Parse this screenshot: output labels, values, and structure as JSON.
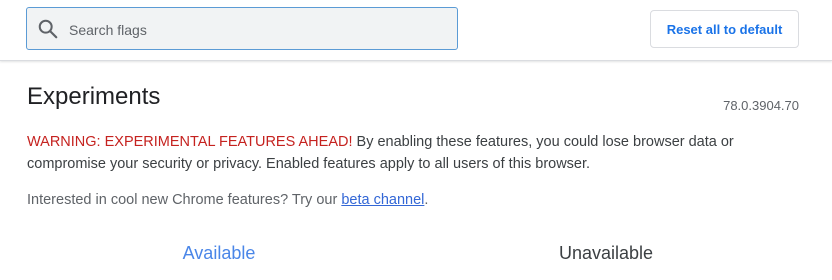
{
  "search": {
    "placeholder": "Search flags",
    "icon": "search-icon"
  },
  "header": {
    "reset_label": "Reset all to default"
  },
  "main": {
    "title": "Experiments",
    "version": "78.0.3904.70",
    "warning_strong": "WARNING: EXPERIMENTAL FEATURES AHEAD!",
    "warning_text": " By enabling these features, you could lose browser data or compromise your security or privacy. Enabled features apply to all users of this browser.",
    "promo_text": "Interested in cool new Chrome features? Try our ",
    "promo_link": "beta channel",
    "promo_end": "."
  },
  "tabs": [
    {
      "label": "Available",
      "selected": true
    },
    {
      "label": "Unavailable",
      "selected": false
    }
  ],
  "colors": {
    "accent": "#1a73e8",
    "warning": "#c5221f",
    "link": "#3367d6"
  }
}
